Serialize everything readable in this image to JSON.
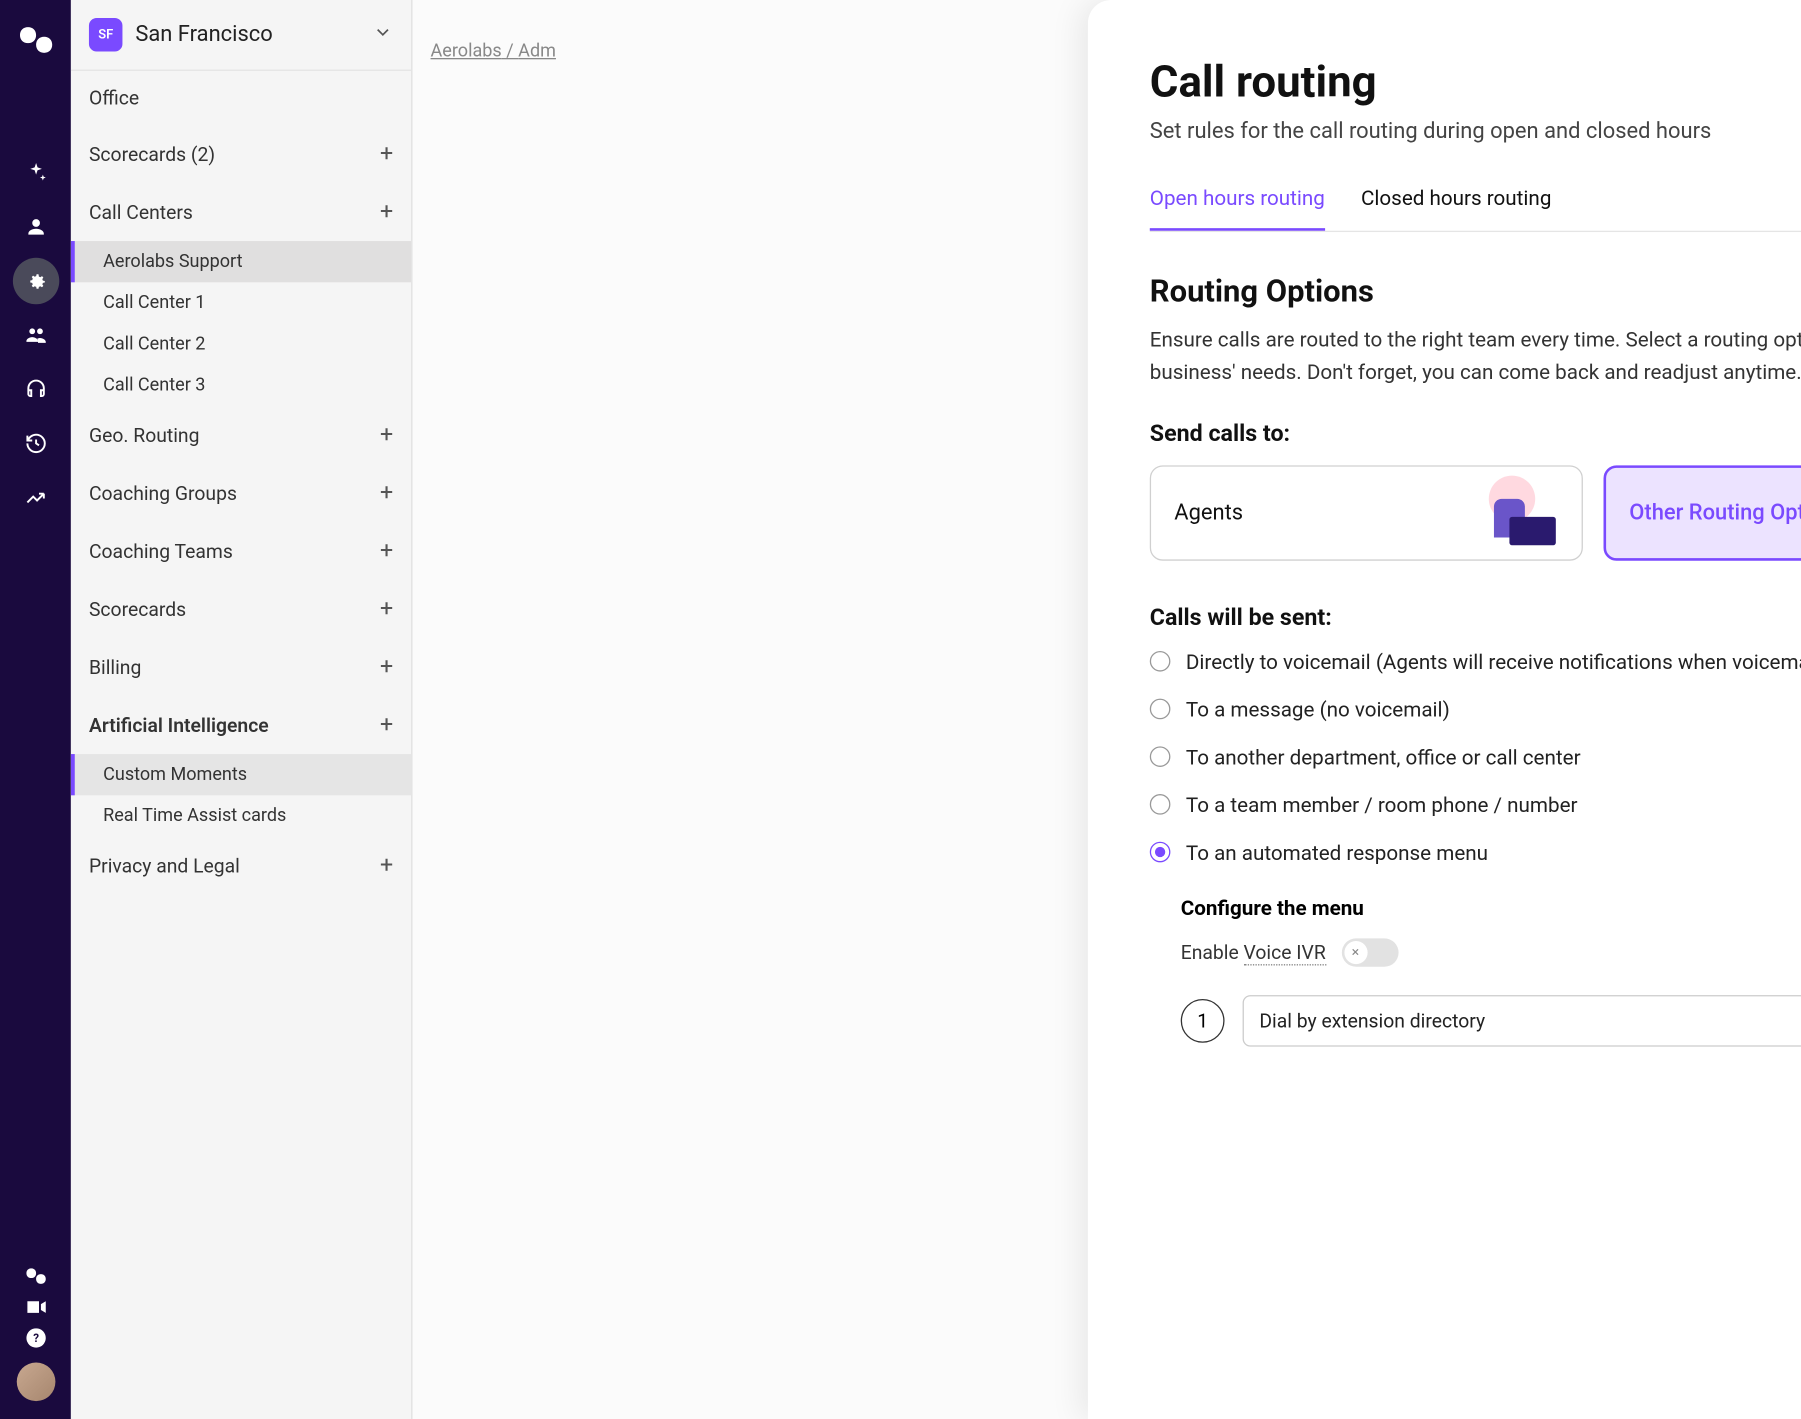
{
  "workspace": {
    "badge": "SF",
    "name": "San Francisco"
  },
  "breadcrumb": {
    "part1": "Aerolabs",
    "sep": " / ",
    "part2": "Adm"
  },
  "sidebar": {
    "office": "Office",
    "scorecards2": "Scorecards (2)",
    "callCenters": "Call Centers",
    "ccItems": [
      "Aerolabs Support",
      "Call Center 1",
      "Call Center 2",
      "Call Center 3"
    ],
    "geo": "Geo. Routing",
    "coachingGroups": "Coaching Groups",
    "coachingTeams": "Coaching Teams",
    "scorecards": "Scorecards",
    "billing": "Billing",
    "ai": "Artificial Intelligence",
    "aiItems": [
      "Custom Moments",
      "Real Time Assist cards"
    ],
    "privacy": "Privacy and Legal"
  },
  "panel": {
    "title": "Call routing",
    "subtitle": "Set rules for the call routing during open and closed hours",
    "tabs": {
      "open": "Open hours routing",
      "closed": "Closed hours routing"
    },
    "routing": {
      "title": "Routing Options",
      "desc": "Ensure calls are routed to the right team every time. Select a routing option below to fit your business' needs. Don't forget, you can come back and readjust anytime.",
      "sendLabel": "Send calls to:",
      "cardAgents": "Agents",
      "cardOther": "Other Routing Options",
      "sentLabel": "Calls will be sent:",
      "options": [
        "Directly to voicemail (Agents will receive notifications when voicemails are left)",
        "To a message (no voicemail)",
        "To another department, office or call center",
        "To a team member / room phone / number",
        "To an automated response menu"
      ],
      "configure": {
        "title": "Configure the menu",
        "ivrLabelPrefix": "Enable ",
        "ivrLabelDotted": "Voice IVR",
        "menuNum": "1",
        "menuSelect": "Dial by extension directory"
      }
    }
  }
}
